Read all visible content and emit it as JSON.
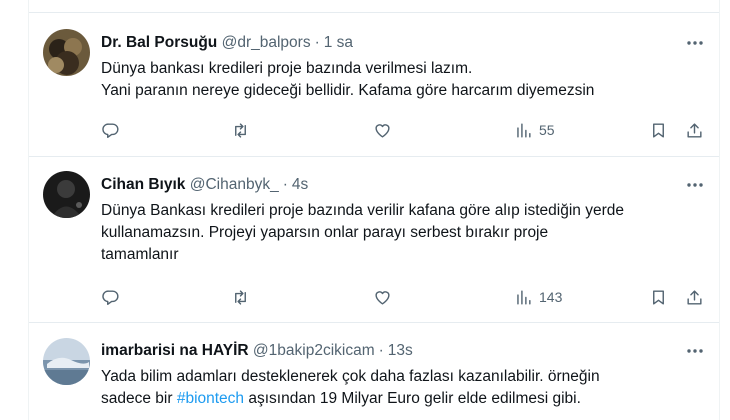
{
  "tweets": [
    {
      "name": "Dr. Bal Porsuğu",
      "handle": "@dr_balpors",
      "time": "1 sa",
      "lines": [
        "Dünya bankası kredileri proje bazında verilmesi lazım.",
        "Yani paranın nereye gideceği bellidir. Kafama göre harcarım diyemezsin"
      ],
      "views": "55"
    },
    {
      "name": "Cihan Bıyık",
      "handle": "@Cihanbyk_",
      "time": "4s",
      "lines": [
        "Dünya Bankası kredileri proje bazında verilir kafana göre alıp istediğin yerde",
        "kullanamazsın. Projeyi yaparsın onlar parayı serbest bırakır proje",
        "tamamlanır"
      ],
      "views": "143"
    },
    {
      "name": "imarbarisi na HAYİR",
      "handle": "@1bakip2cikicam",
      "time": "13s",
      "line1": "Yada bilim adamları desteklenerek çok daha fazlası kazanılabilir. örneğin",
      "line2_pre": "sadece bir ",
      "line2_hashtag": "#biontech",
      "line2_post": " aşısından 19 Milyar Euro gelir elde edilmesi gibi."
    }
  ],
  "separator": "·",
  "colors": {
    "link": "#1d9bf0",
    "secondary": "#536471",
    "text": "#0f1419"
  },
  "icons": [
    "more-icon",
    "reply-icon",
    "retweet-icon",
    "like-icon",
    "views-icon",
    "bookmark-icon",
    "share-icon"
  ]
}
